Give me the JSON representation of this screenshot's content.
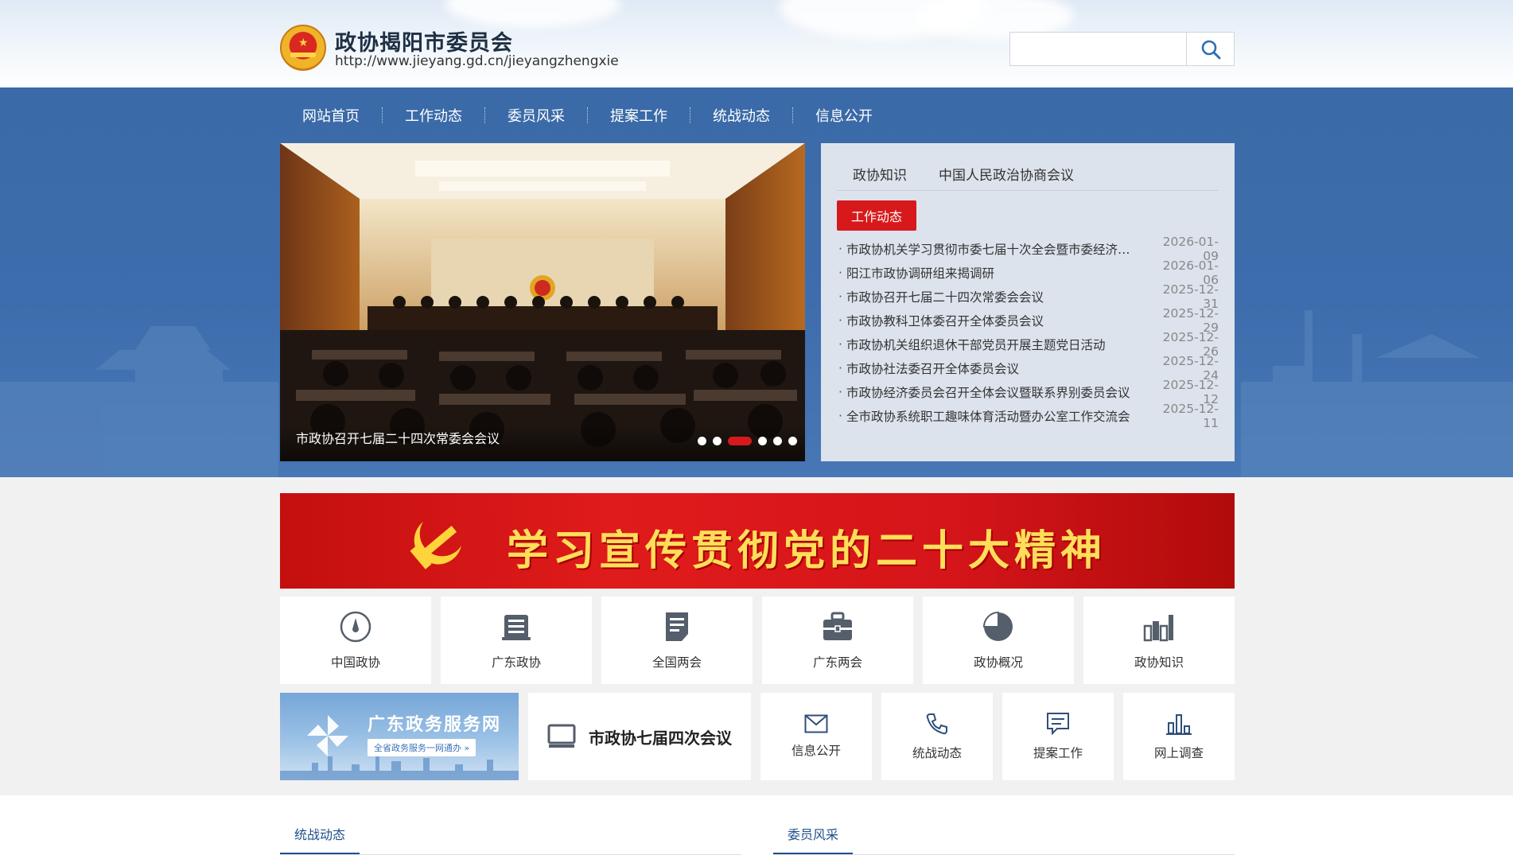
{
  "colors": {
    "nav_blue": "#3a6aa7",
    "accent_red": "#d7191c",
    "text_dark": "#333333",
    "date_gray": "#888888",
    "section_blue": "#1d4f8d"
  },
  "header": {
    "title": "政协揭阳市委员会",
    "url": "http://www.jieyang.gd.cn/jieyangzhengxie",
    "search": {
      "placeholder": "",
      "button_icon": "search-icon"
    }
  },
  "nav": {
    "items": [
      "网站首页",
      "工作动态",
      "委员风采",
      "提案工作",
      "统战动态",
      "信息公开"
    ]
  },
  "slider": {
    "caption": "市政协召开七届二十四次常委会会议",
    "slide_count": 6,
    "active_index": 2
  },
  "news_panel": {
    "top_tabs": [
      "政协知识",
      "中国人民政治协商会议"
    ],
    "active_tab": "工作动态",
    "items": [
      {
        "title": "市政协机关学习贯彻市委七届十次全会暨市委经济工作会议精神",
        "date": "2026-01-09"
      },
      {
        "title": "阳江市政协调研组来揭调研",
        "date": "2026-01-06"
      },
      {
        "title": "市政协召开七届二十四次常委会会议",
        "date": "2025-12-31"
      },
      {
        "title": "市政协教科卫体委召开全体委员会议",
        "date": "2025-12-29"
      },
      {
        "title": "市政协机关组织退休干部党员开展主题党日活动",
        "date": "2025-12-26"
      },
      {
        "title": "市政协社法委召开全体委员会议",
        "date": "2025-12-24"
      },
      {
        "title": "市政协经济委员会召开全体会议暨联系界别委员会议",
        "date": "2025-12-12"
      },
      {
        "title": "全市政协系统职工趣味体育活动暨办公室工作交流会",
        "date": "2025-12-11"
      }
    ]
  },
  "banner": {
    "text": "学习宣传贯彻党的二十大精神"
  },
  "tiles_row1": [
    {
      "label": "中国政协",
      "icon": "compass-icon"
    },
    {
      "label": "广东政协",
      "icon": "document-stack-icon"
    },
    {
      "label": "全国两会",
      "icon": "document-icon"
    },
    {
      "label": "广东两会",
      "icon": "briefcase-icon"
    },
    {
      "label": "政协概况",
      "icon": "pie-chart-icon"
    },
    {
      "label": "政协知识",
      "icon": "bar-chart-icon"
    }
  ],
  "tiles_row2": {
    "service": {
      "title": "广东政务服务网",
      "subtitle": "全省政务服务一网通办 »"
    },
    "conference": {
      "label": "市政协七届四次会议",
      "icon": "monitor-icon"
    },
    "items": [
      {
        "label": "信息公开",
        "icon": "mail-icon"
      },
      {
        "label": "统战动态",
        "icon": "phone-icon"
      },
      {
        "label": "提案工作",
        "icon": "chat-icon"
      },
      {
        "label": "网上调查",
        "icon": "survey-chart-icon"
      }
    ]
  },
  "bottom": {
    "left_section": "统战动态",
    "right_section": "委员风采"
  }
}
